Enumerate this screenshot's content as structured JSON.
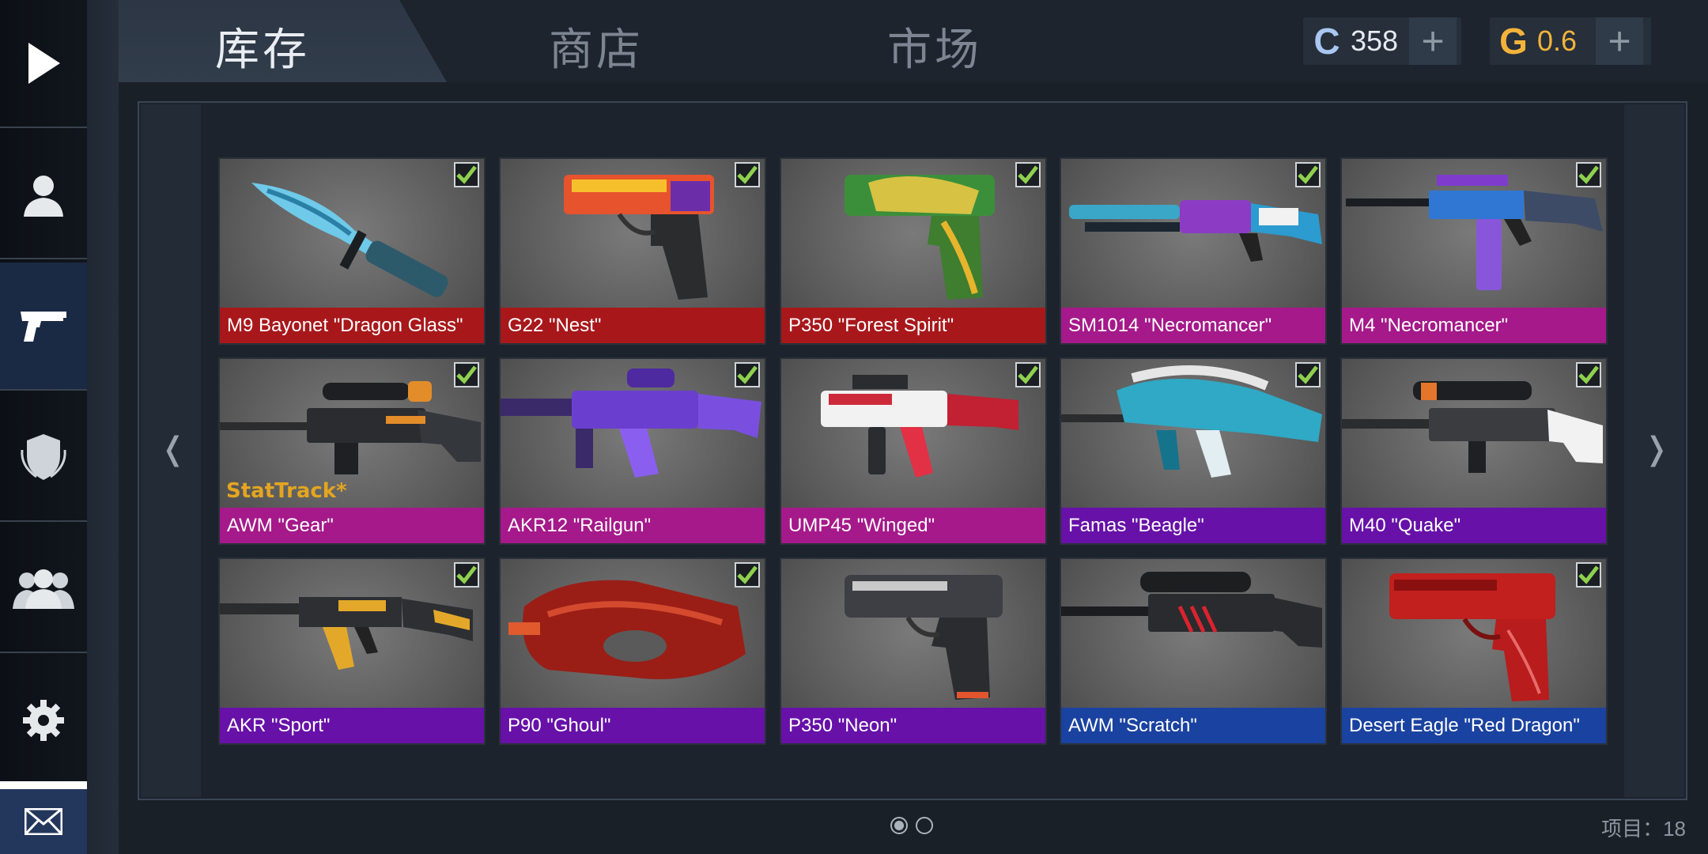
{
  "nav": {
    "tabs": [
      {
        "label": "库存",
        "active": true
      },
      {
        "label": "商店",
        "active": false
      },
      {
        "label": "市场",
        "active": false
      }
    ]
  },
  "sidebar": {
    "items": [
      {
        "name": "play",
        "icon": "play-icon"
      },
      {
        "name": "profile",
        "icon": "user-icon"
      },
      {
        "name": "inventory",
        "icon": "pistol-icon",
        "active": true
      },
      {
        "name": "clan",
        "icon": "shield-icon"
      },
      {
        "name": "friends",
        "icon": "friends-icon"
      },
      {
        "name": "settings",
        "icon": "gear-icon"
      },
      {
        "name": "mail",
        "icon": "mail-icon"
      }
    ]
  },
  "currency": {
    "silver": {
      "value": "358",
      "icon": "C",
      "color": "#a9c7f0"
    },
    "gold": {
      "value": "0.6",
      "icon": "G",
      "color": "#f3b33a"
    }
  },
  "items": [
    {
      "name": "M9 Bayonet \"Dragon Glass\"",
      "rarity": "red",
      "checked": true,
      "stattrack": false
    },
    {
      "name": "G22 \"Nest\"",
      "rarity": "red",
      "checked": true,
      "stattrack": false
    },
    {
      "name": "P350 \"Forest Spirit\"",
      "rarity": "red",
      "checked": true,
      "stattrack": false
    },
    {
      "name": "SM1014 \"Necromancer\"",
      "rarity": "pink",
      "checked": true,
      "stattrack": false
    },
    {
      "name": "M4 \"Necromancer\"",
      "rarity": "pink",
      "checked": true,
      "stattrack": false
    },
    {
      "name": "AWM \"Gear\"",
      "rarity": "pink",
      "checked": true,
      "stattrack": true
    },
    {
      "name": "AKR12 \"Railgun\"",
      "rarity": "pink",
      "checked": true,
      "stattrack": false
    },
    {
      "name": "UMP45 \"Winged\"",
      "rarity": "pink",
      "checked": true,
      "stattrack": false
    },
    {
      "name": "Famas \"Beagle\"",
      "rarity": "purple",
      "checked": true,
      "stattrack": false
    },
    {
      "name": "M40 \"Quake\"",
      "rarity": "purple",
      "checked": true,
      "stattrack": false
    },
    {
      "name": "AKR \"Sport\"",
      "rarity": "purple",
      "checked": true,
      "stattrack": false
    },
    {
      "name": "P90 \"Ghoul\"",
      "rarity": "purple",
      "checked": true,
      "stattrack": false
    },
    {
      "name": "P350 \"Neon\"",
      "rarity": "purple",
      "checked": false,
      "stattrack": false
    },
    {
      "name": "AWM \"Scratch\"",
      "rarity": "blue",
      "checked": false,
      "stattrack": false
    },
    {
      "name": "Desert Eagle \"Red Dragon\"",
      "rarity": "blue",
      "checked": true,
      "stattrack": false
    }
  ],
  "stattrack_label": "StatTrack*",
  "arrows": {
    "left": "❬",
    "right": "❭"
  },
  "pager": {
    "pages": 2,
    "current": 1
  },
  "count_label": "项目：18",
  "colors": {
    "red": "#a8181b",
    "pink": "#a5198a",
    "purple": "#6711a8",
    "blue": "#1a42a0",
    "check": "#8fd14f"
  }
}
